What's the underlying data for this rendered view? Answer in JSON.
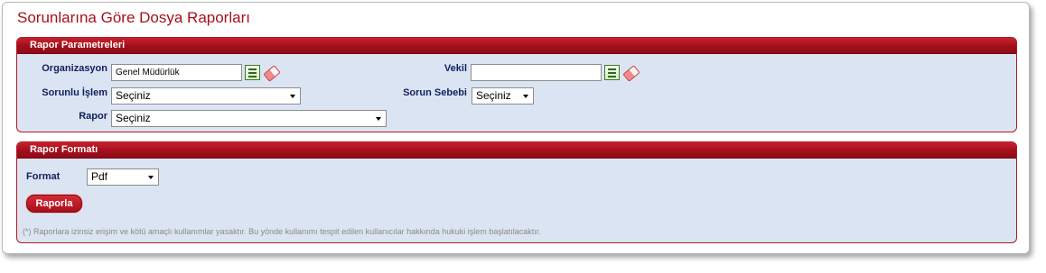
{
  "page": {
    "title": "Sorunlarına Göre Dosya Raporları"
  },
  "params_panel": {
    "header": "Rapor Parametreleri",
    "organizasyon": {
      "label": "Organizasyon",
      "value": "Genel Müdürlük"
    },
    "vekil": {
      "label": "Vekil",
      "value": ""
    },
    "sorunlu_islem": {
      "label": "Sorunlu İşlem",
      "selected": "Seçiniz"
    },
    "sorun_sebebi": {
      "label": "Sorun Sebebi",
      "selected": "Seçiniz"
    },
    "rapor": {
      "label": "Rapor",
      "selected": "Seçiniz"
    }
  },
  "format_panel": {
    "header": "Rapor Formatı",
    "format": {
      "label": "Format",
      "selected": "Pdf"
    },
    "report_button": "Raporla",
    "note": "(*) Raporlara izinsiz erişim ve kötü amaçlı kullanımlar yasaktır. Bu yönde kullanımı tespit edilen kullanıcılar hakkında hukuki işlem başlatılacaktır."
  },
  "icons": {
    "list": "list-select-icon",
    "eraser": "eraser-clear-icon"
  },
  "colors": {
    "accent": "#a6101a",
    "panel_bg": "#dbe4f2",
    "label": "#14205e"
  }
}
